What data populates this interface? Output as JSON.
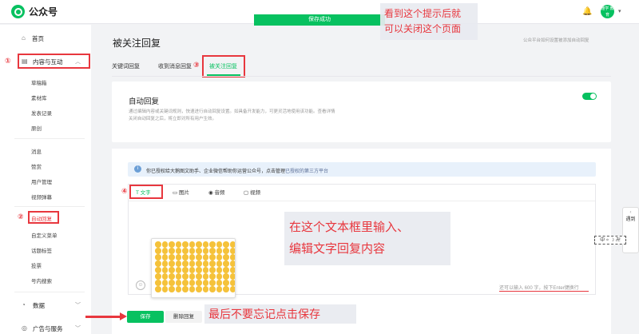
{
  "header": {
    "app_name": "公众号",
    "toast": "保存成功",
    "avatar_text": "雅学 教育",
    "bell_icon": "bell-icon",
    "caret_icon": "chevron-down-icon"
  },
  "sidebar": {
    "home": "首页",
    "content_section": "内容与互动",
    "content_items": [
      "草稿箱",
      "素材库",
      "发表记录",
      "原创"
    ],
    "interact_items": [
      "消息",
      "赞赏",
      "用户管理",
      "视频弹幕"
    ],
    "auto_reply": "自动回复",
    "other_items": [
      "自定义菜单",
      "话题标签",
      "投票",
      "号内搜索"
    ],
    "data_section": "数据",
    "ads_section": "广告与服务"
  },
  "main": {
    "page_title": "被关注回复",
    "help_text": "公众平台如何设置被添加自动回复",
    "tabs": [
      "关键词回复",
      "收到消息回复",
      "被关注回复"
    ],
    "auto_reply_card": {
      "title": "自动回复",
      "desc_line1": "通过编辑内容或关键词规则，快速进行自动回复设置。如具备开发能力，可更灵活地使用该功能。查看详情",
      "desc_line2": "关闭自动回复之后，将立即对所有用户生效。"
    },
    "notice": {
      "text": "你已授权给大鹅图文助手、企业微信帮助你运营公众号，点击管理",
      "link": "已授权的第三方平台"
    },
    "editor_tabs": [
      "文字",
      "图片",
      "音频",
      "视频"
    ],
    "counter": "还可以输入 600 字，按下Enter键换行",
    "save_button": "保存",
    "delete_button": "删除回复"
  },
  "annotations": {
    "markers": [
      "①",
      "②",
      "③",
      "④"
    ],
    "top_line1": "看到这个提示后就",
    "top_line2": "可以关闭这个页面",
    "mid_line1": "在这个文本框里输入、",
    "mid_line2": "编辑文字回复内容",
    "bottom": "最后不要忘记点击保存"
  },
  "float": {
    "text": "遇到",
    "ime": "中 ⸰ ☽ 卍"
  },
  "colors": {
    "brand": "#07c160",
    "annotation": "#e8373e",
    "notice_bg": "#e8f1fb"
  }
}
